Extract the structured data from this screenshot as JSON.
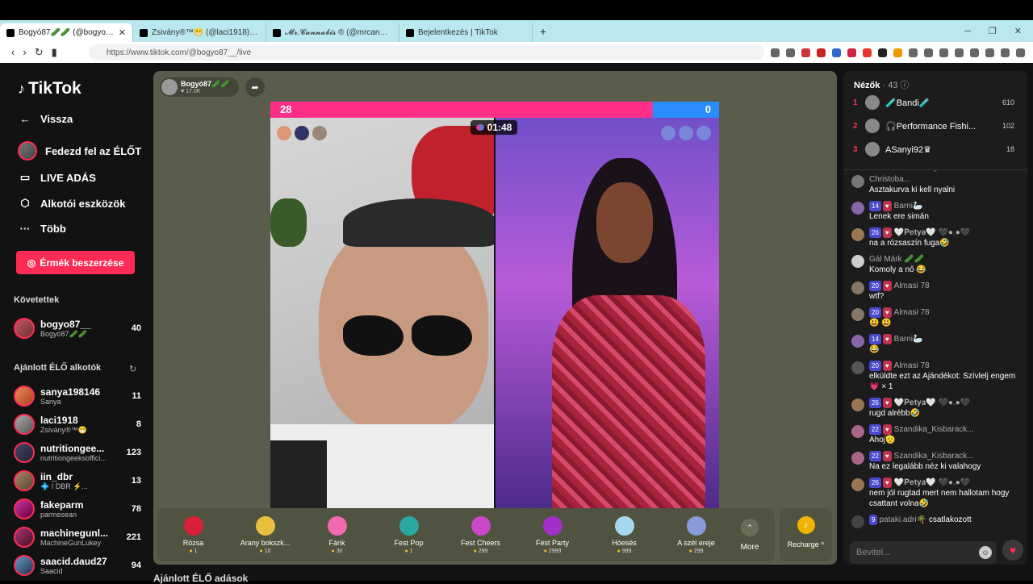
{
  "browser": {
    "tabs": [
      {
        "title": "Bogyó87🥒🥒 (@bogyo87_",
        "active": true
      },
      {
        "title": "Zsivány®™😁 (@laci1918) ÉLŐ",
        "active": false
      },
      {
        "title": "𝓜𝓻.𝓒𝓪𝓷𝓷𝓪𝓫𝓲𝓼 ® (@mrcannabis_",
        "active": false
      },
      {
        "title": "Bejelentkezés | TikTok",
        "active": false
      }
    ],
    "url": "https://www.tiktok.com/@bogyo87__/live"
  },
  "sidebar": {
    "logo": "TikTok",
    "menu": {
      "back": "Vissza",
      "explore": "Fedezd fel az ÉLŐT",
      "live": "LIVE ADÁS",
      "tools": "Alkotói eszközök",
      "more": "Több"
    },
    "coins_button": "Érmék beszerzése",
    "following_title": "Követettek",
    "following": [
      {
        "name": "bogyo87__",
        "sub": "Bogyó87🥒🥒",
        "count": "40"
      }
    ],
    "recommended_title": "Ajánlott ÉLŐ alkotók",
    "recommended": [
      {
        "name": "sanya198146",
        "sub": "Sanya",
        "count": "11"
      },
      {
        "name": "laci1918",
        "sub": "Zsivány®™😁",
        "count": "8"
      },
      {
        "name": "nutritiongee...",
        "sub": "nutritiongeeksoffici...",
        "count": "123"
      },
      {
        "name": "iin_dbr",
        "sub": "💠 I DBR ⚡...",
        "count": "13"
      },
      {
        "name": "fakeparm",
        "sub": "parmesean",
        "count": "78"
      },
      {
        "name": "machinegunl...",
        "sub": "MachineGunLukey",
        "count": "221"
      },
      {
        "name": "saacid.daud27",
        "sub": "Saacid",
        "count": "94"
      }
    ]
  },
  "stream": {
    "host_name": "Bogyó87🥒🥒",
    "host_likes": "♥ 17.0K",
    "battle_left": "28",
    "battle_right": "0",
    "timer": "01:48",
    "gifts": [
      {
        "name": "Rózsa",
        "price": "1",
        "color": "#d8203a"
      },
      {
        "name": "Arany bokszk...",
        "price": "10",
        "color": "#e8c040"
      },
      {
        "name": "Fánk",
        "price": "30",
        "color": "#f06ab0"
      },
      {
        "name": "Fest Pop",
        "price": "1",
        "color": "#2aa8a0"
      },
      {
        "name": "Fest Cheers",
        "price": "299",
        "color": "#c84ac8"
      },
      {
        "name": "Fest Party",
        "price": "2999",
        "color": "#a030c8"
      },
      {
        "name": "Hóesés",
        "price": "999",
        "color": "#a8d8f0"
      },
      {
        "name": "A szél ereje",
        "price": "299",
        "color": "#8a9ad8"
      }
    ],
    "more_label": "More",
    "recharge_label": "Recharge ^",
    "below_title": "Ajánlott ÉLŐ adások"
  },
  "panel": {
    "viewers_label": "Nézők",
    "viewers_count": "· 43",
    "top": [
      {
        "rank": "1",
        "name": "🧪Bandi🧪",
        "score": "610"
      },
      {
        "rank": "2",
        "name": "🎧Performance Fishi...",
        "score": "102"
      },
      {
        "rank": "3",
        "name": "ASanyi92♛",
        "score": "18"
      }
    ],
    "chat": [
      {
        "lvl": "",
        "user": "Christoba...",
        "text": "Asztakurva ki kell nyalni"
      },
      {
        "lvl": "14",
        "user": "Barni🦢",
        "text": "Lenek ere simán"
      },
      {
        "lvl": "26",
        "user": "🤍𝐏𝐞𝐭𝐲𝐚🤍 🖤●.●🖤",
        "text": "na a rózsaszín fuga🤣"
      },
      {
        "lvl": "",
        "user": "Gál Márk 🥒🥒",
        "text": "Komoly a nő 😂"
      },
      {
        "lvl": "20",
        "user": "Almasi 78",
        "text": "wtf?"
      },
      {
        "lvl": "20",
        "user": "Almasi 78",
        "text": "😃 😃"
      },
      {
        "lvl": "14",
        "user": "Barni🦢",
        "text": "😂"
      },
      {
        "lvl": "20",
        "user": "Almasi 78",
        "text": "elküldte ezt az Ajándékot: Szívlelj engem 💗 × 1"
      },
      {
        "lvl": "26",
        "user": "🤍𝐏𝐞𝐭𝐲𝐚🤍 🖤●.●🖤",
        "text": "rugd alrébb🤣"
      },
      {
        "lvl": "22",
        "user": "Szandika_Kisbarack...",
        "text": "Ahoj🫡"
      },
      {
        "lvl": "22",
        "user": "Szandika_Kisbarack...",
        "text": "Na ez legalább néz ki valahogy"
      },
      {
        "lvl": "26",
        "user": "🤍𝐏𝐞𝐭𝐲𝐚🤍 🖤●.●🖤",
        "text": "nem jól rugtad mert nem hallotam hogy csattant volna🤣"
      },
      {
        "lvl": "9",
        "user": "pataki.adri🌴",
        "text": "csatlakozott"
      }
    ],
    "input_placeholder": "Bevitel..."
  }
}
